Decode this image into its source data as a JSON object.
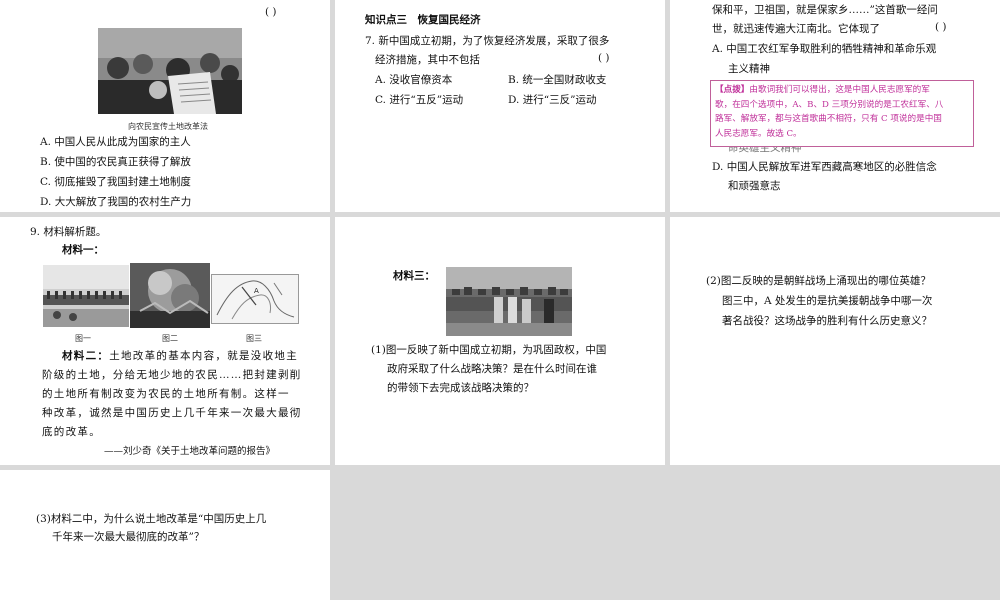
{
  "panel1": {
    "paren": "(      )",
    "photo_caption": "向农民宣传土地改革法",
    "options": [
      "A. 中国人民从此成为国家的主人",
      "B. 使中国的农民真正获得了解放",
      "C. 彻底摧毁了我国封建土地制度",
      "D. 大大解放了我国的农村生产力"
    ]
  },
  "panel2": {
    "section_title": "知识点三　恢复国民经济",
    "q7_line1": "7. 新中国成立初期，为了恢复经济发展，采取了很多",
    "q7_line2": "经济措施，其中不包括",
    "paren": "(      )",
    "opt_a": "A. 没收官僚资本",
    "opt_b": "B. 统一全国财政收支",
    "opt_c": "C. 进行“五反”运动",
    "opt_d": "D. 进行“三反”运动"
  },
  "panel3": {
    "line1": "保和平，卫祖国，就是保家乡……”这首歌一经问",
    "line2": "世，就迅速传遍大江南北。它体现了",
    "paren": "(      )",
    "opt_a1": "A. 中国工农红军争取胜利的牺牲精神和革命乐观",
    "opt_a2": "主义精神",
    "note_tag": "【点拨】",
    "note_lines": [
      "由歌词我们可以得出，这是中国人民志愿军的军",
      "歌，在四个选项中，A、B、D 三项分别说的是工农红军、八",
      "路军、解放军，都与这首歌曲不相符，只有 C 项说的是中国",
      "人民志愿军。故选 C。"
    ],
    "hidden_fragment": "命英雄主义精神",
    "opt_d1": "D. 中国人民解放军进军西藏高寒地区的必胜信念",
    "opt_d2": "和顽强意志"
  },
  "panel4": {
    "q9": "9. 材料解析题。",
    "mat1": "材料一：",
    "fig_labels": [
      "图一",
      "图二",
      "图三"
    ],
    "mat2_label": "材料二：",
    "mat2_lines": [
      "土地改革的基本内容，就是没收地主",
      "阶级的土地，分给无地少地的农民……把封建剥削",
      "的土地所有制改变为农民的土地所有制。这样一",
      "种改革，诚然是中国历史上几千年来一次最大最彻",
      "底的改革。"
    ],
    "source": "——刘少奇《关于土地改革问题的报告》"
  },
  "panel5": {
    "mat3": "材料三：",
    "q1_lines": [
      "(1)图一反映了新中国成立初期，为巩固政权，中国",
      "政府采取了什么战略决策？是在什么时间在谁",
      "的带领下去完成该战略决策的？"
    ]
  },
  "panel6": {
    "q2_lines": [
      "(2)图二反映的是朝鲜战场上涌现出的哪位英雄？",
      "图三中，A 处发生的是抗美援朝战争中哪一次",
      "著名战役？这场战争的胜利有什么历史意义？"
    ]
  },
  "panel7": {
    "q3_lines": [
      "(3)材料二中，为什么说土地改革是“中国历史上几",
      "千年来一次最大最彻底的改革”？"
    ]
  },
  "colors": {
    "note_border": "#c0609a",
    "note_text": "#c0309a",
    "gap": "#d9d9d9"
  }
}
